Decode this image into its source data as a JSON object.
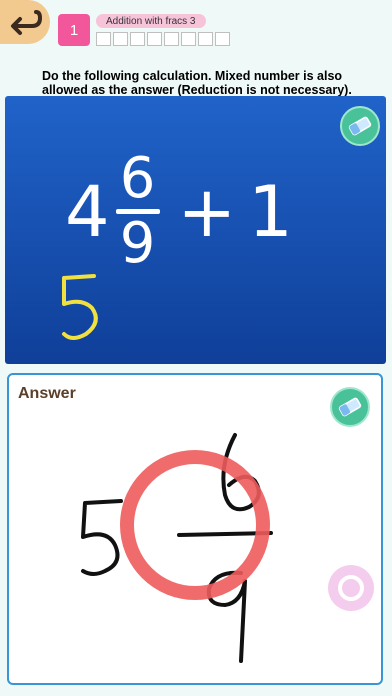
{
  "header": {
    "question_number": "1",
    "lesson_title": "Addition with fracs 3",
    "progress": {
      "completed": 0,
      "total": 8
    }
  },
  "instruction": "Do the following calculation. Mixed number is also allowed as the answer (Reduction is not necessary).",
  "problem": {
    "whole": "4",
    "numerator": "6",
    "denominator": "9",
    "operator": "+",
    "addend": "1",
    "handwritten_note": "5"
  },
  "answer": {
    "label": "Answer",
    "handwritten_answer": "5 6/9",
    "marked_correct": true
  },
  "colors": {
    "board_top": "#2063c9",
    "board_bottom": "#0f3f99",
    "accent_pink": "#f2569b",
    "correct_ring": "#ee5c5c",
    "eraser_green": "#49c29a",
    "handwriting_yellow": "#f0e040"
  },
  "icons": [
    "back-arrow-icon",
    "eraser-icon",
    "submit-circle-icon"
  ]
}
